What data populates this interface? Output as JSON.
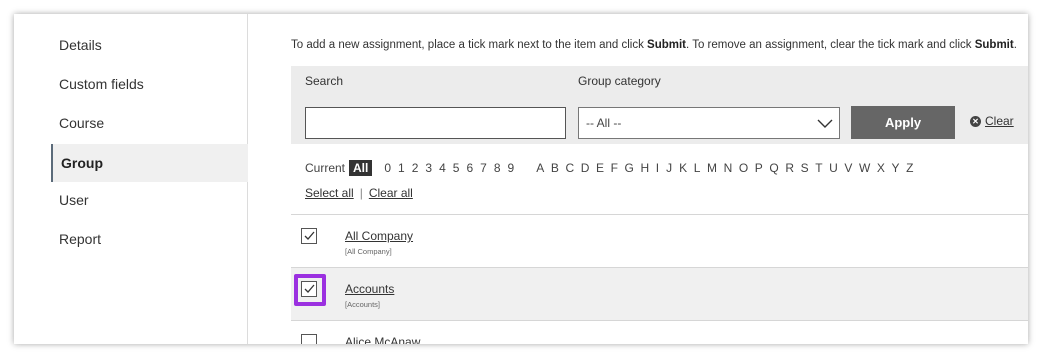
{
  "sidebar": {
    "items": [
      {
        "label": "Details"
      },
      {
        "label": "Custom fields"
      },
      {
        "label": "Course"
      },
      {
        "label": "Group",
        "active": true
      },
      {
        "label": "User"
      },
      {
        "label": "Report"
      }
    ]
  },
  "instructions": {
    "part1": "To add a new assignment, place a tick mark next to the item and click ",
    "bold1": "Submit",
    "part2": ". To remove an assignment, clear the tick mark and click ",
    "bold2": "Submit",
    "part3": "."
  },
  "filters": {
    "search_label": "Search",
    "search_value": "",
    "group_category_label": "Group category",
    "group_category_value": "-- All --",
    "apply_label": "Apply",
    "clear_label": "Clear"
  },
  "alpha": {
    "current_label": "Current",
    "all_label": "All",
    "letters": [
      "0",
      "1",
      "2",
      "3",
      "4",
      "5",
      "6",
      "7",
      "8",
      "9",
      "A",
      "B",
      "C",
      "D",
      "E",
      "F",
      "G",
      "H",
      "I",
      "J",
      "K",
      "L",
      "M",
      "N",
      "O",
      "P",
      "Q",
      "R",
      "S",
      "T",
      "U",
      "V",
      "W",
      "X",
      "Y",
      "Z"
    ]
  },
  "select_links": {
    "select_all": "Select all",
    "clear_all": "Clear all"
  },
  "rows": [
    {
      "title": "All Company",
      "subtitle": "[All Company]",
      "checked": true
    },
    {
      "title": "Accounts",
      "subtitle": "[Accounts]",
      "checked": true,
      "highlighted": true
    },
    {
      "title": "Alice McAnaw",
      "subtitle": "",
      "checked": false
    }
  ],
  "colors": {
    "highlight": "#9b30e0",
    "apply_button": "#666666"
  }
}
